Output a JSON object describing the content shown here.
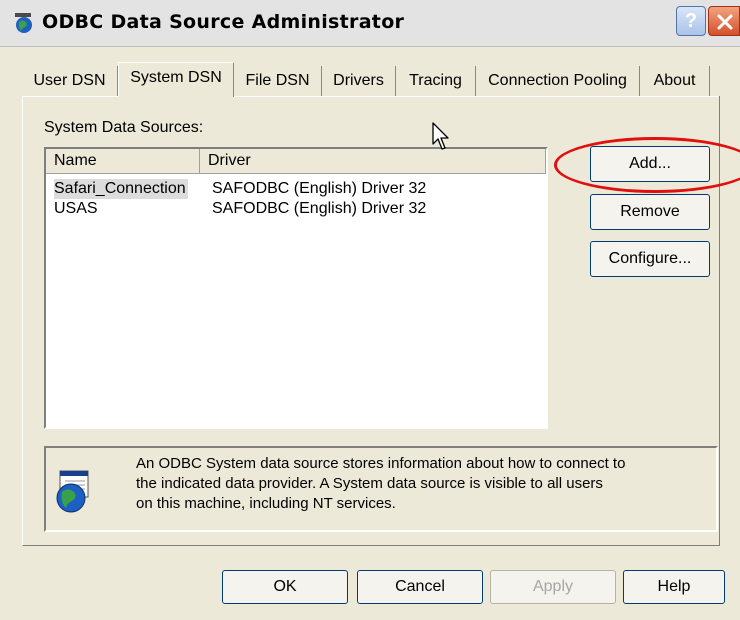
{
  "window": {
    "title": "ODBC Data Source Administrator",
    "help_glyph": "?",
    "app_icon": "odbc-globe-icon"
  },
  "tabs": [
    {
      "label": "User DSN"
    },
    {
      "label": "System DSN",
      "active": true
    },
    {
      "label": "File DSN"
    },
    {
      "label": "Drivers"
    },
    {
      "label": "Tracing"
    },
    {
      "label": "Connection Pooling"
    },
    {
      "label": "About"
    }
  ],
  "system_dsn": {
    "section_label": "System Data Sources:",
    "columns": [
      "Name",
      "Driver"
    ],
    "rows": [
      {
        "name": "Safari_Connection",
        "driver": "SAFODBC (English) Driver 32",
        "selected": true
      },
      {
        "name": "USAS",
        "driver": "SAFODBC (English) Driver 32"
      }
    ],
    "buttons": {
      "add": "Add...",
      "remove": "Remove",
      "configure": "Configure..."
    },
    "info": {
      "icon": "globe-database-icon",
      "lines": [
        "An ODBC System data source stores information about how to connect to",
        "the indicated data provider.  A System data source is visible to all users",
        "on this machine, including NT services."
      ]
    }
  },
  "footer": {
    "ok": "OK",
    "cancel": "Cancel",
    "apply": "Apply",
    "help": "Help"
  },
  "annotation_color": "#e01010"
}
